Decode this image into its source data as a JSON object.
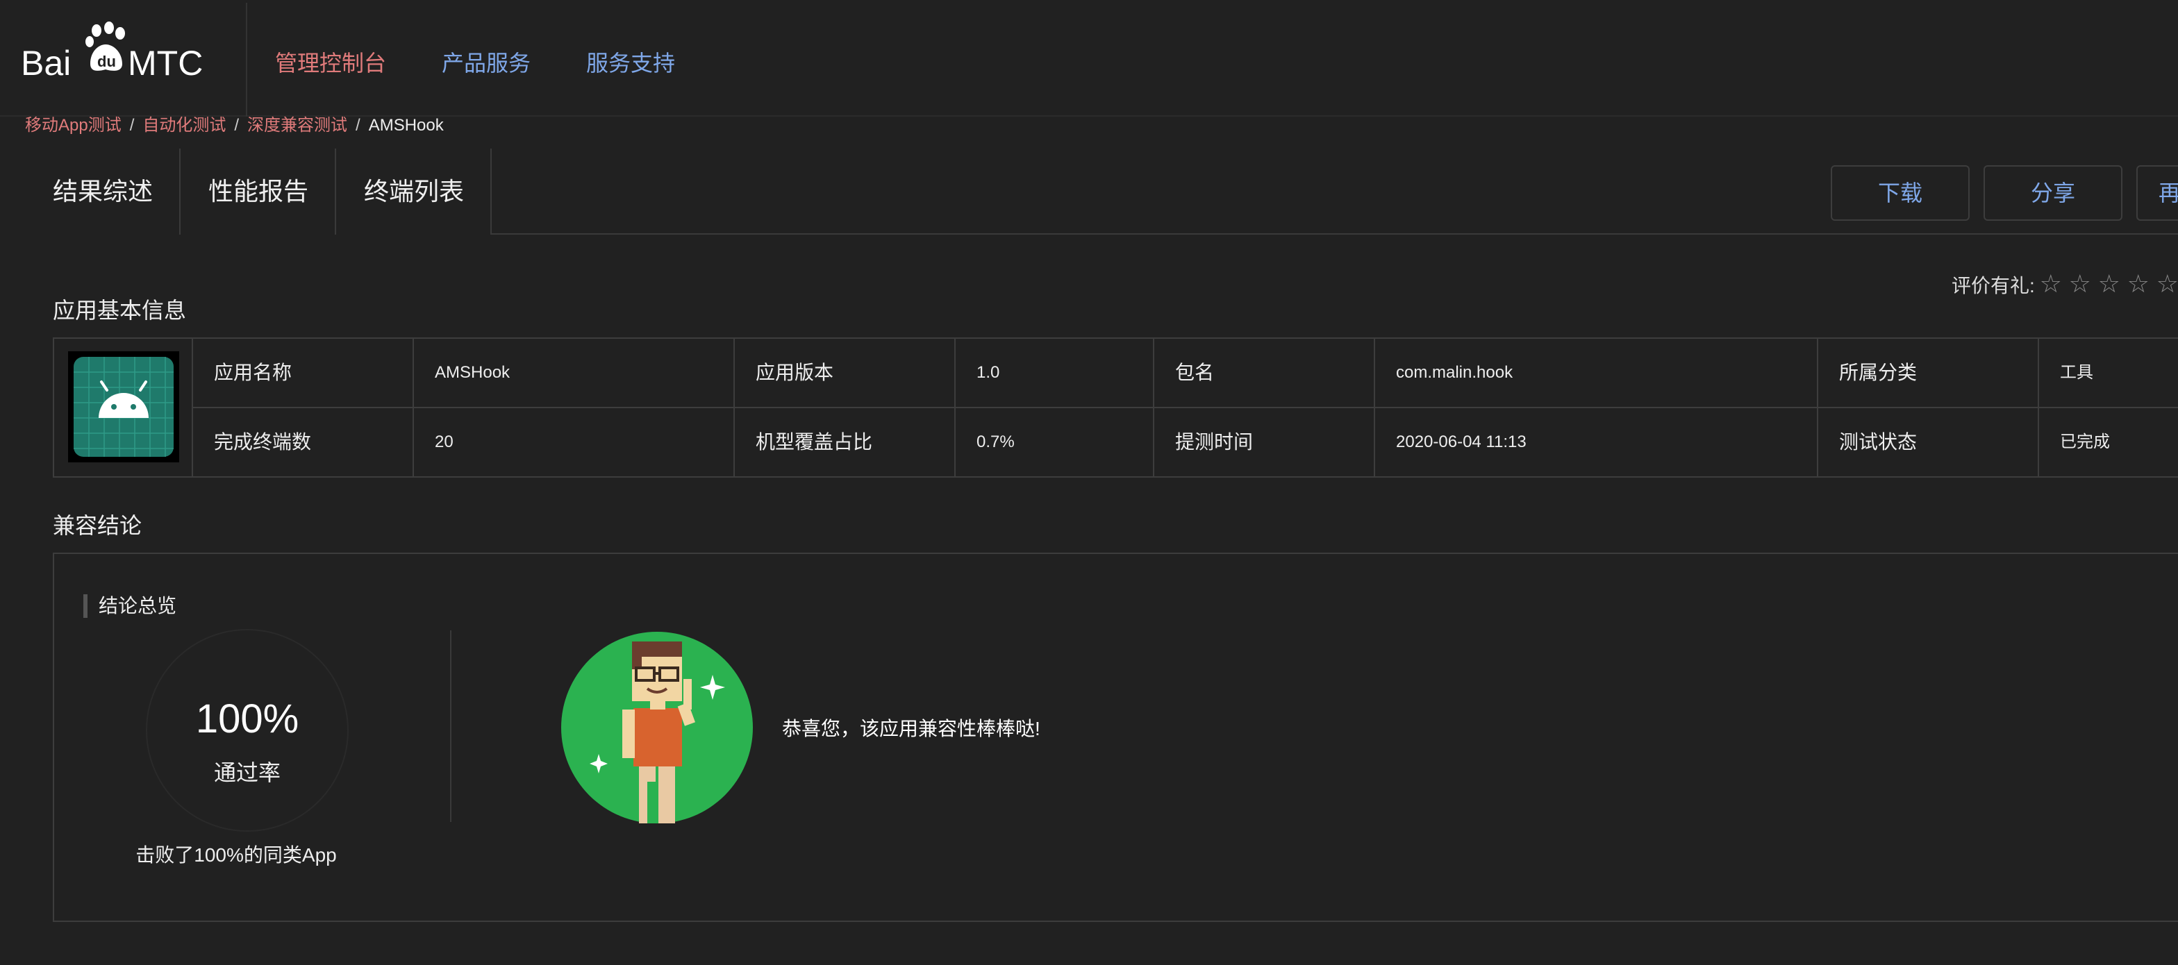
{
  "header": {
    "logo_text": "Bai MTC",
    "nav": {
      "console": "管理控制台",
      "products": "产品服务",
      "support": "服务支持"
    }
  },
  "breadcrumb": {
    "items": [
      "移动App测试",
      "自动化测试",
      "深度兼容测试"
    ],
    "current": "AMSHook"
  },
  "tabs": [
    "结果综述",
    "性能报告",
    "终端列表"
  ],
  "actions": {
    "download": "下载",
    "share": "分享",
    "retest": "再"
  },
  "rating": {
    "label": "评价有礼:",
    "stars": 5
  },
  "app_info": {
    "section_title": "应用基本信息",
    "row1": [
      {
        "label": "应用名称",
        "value": "AMSHook"
      },
      {
        "label": "应用版本",
        "value": "1.0"
      },
      {
        "label": "包名",
        "value": "com.malin.hook"
      },
      {
        "label": "所属分类",
        "value": "工具"
      }
    ],
    "row2": [
      {
        "label": "完成终端数",
        "value": "20"
      },
      {
        "label": "机型覆盖占比",
        "value": "0.7%"
      },
      {
        "label": "提测时间",
        "value": "2020-06-04 11:13"
      },
      {
        "label": "测试状态",
        "value": "已完成"
      }
    ]
  },
  "compat": {
    "section_title": "兼容结论",
    "subtitle": "结论总览",
    "pass_rate": "100%",
    "pass_label": "通过率",
    "beat_text": "击败了100%的同类App",
    "message": "恭喜您，该应用兼容性棒棒哒!"
  },
  "colors": {
    "background": "#212121",
    "accent_red": "#e07b7b",
    "link_blue": "#7fa7e8",
    "icon_green": "#2bb250"
  }
}
